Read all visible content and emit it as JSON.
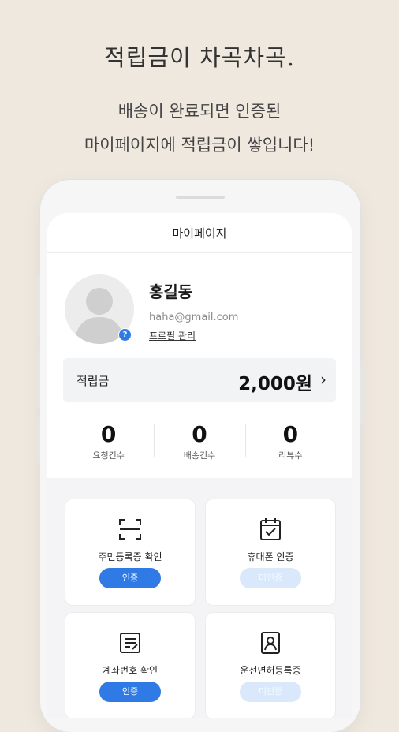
{
  "promo": {
    "headline": "적립금이 차곡차곡.",
    "sub_line1": "배송이 완료되면 인증된",
    "sub_line2": "마이페이지에 적립금이 쌓입니다!"
  },
  "screen": {
    "title": "마이페이지",
    "profile": {
      "name": "홍길동",
      "email": "haha@gmail.com",
      "manage_link": "프로필 관리",
      "badge": "?"
    },
    "points": {
      "label": "적립금",
      "value": "2,000원",
      "chevron": "›"
    },
    "stats": [
      {
        "value": "0",
        "label": "요청건수"
      },
      {
        "value": "0",
        "label": "배송건수"
      },
      {
        "value": "0",
        "label": "리뷰수"
      }
    ],
    "cards": [
      {
        "title": "주민등록증 확인",
        "button": "인증",
        "state": "active",
        "icon": "id-scan-icon"
      },
      {
        "title": "휴대폰 인증",
        "button": "미인증",
        "state": "inactive",
        "icon": "calendar-check-icon"
      },
      {
        "title": "계좌번호 확인",
        "button": "인증",
        "state": "active",
        "icon": "document-pen-icon"
      },
      {
        "title": "운전면허등록증",
        "button": "미인증",
        "state": "inactive",
        "icon": "person-card-icon"
      }
    ]
  },
  "colors": {
    "background": "#efe8de",
    "accent": "#2f7ae5",
    "inactive_button": "#d9e8fb"
  }
}
